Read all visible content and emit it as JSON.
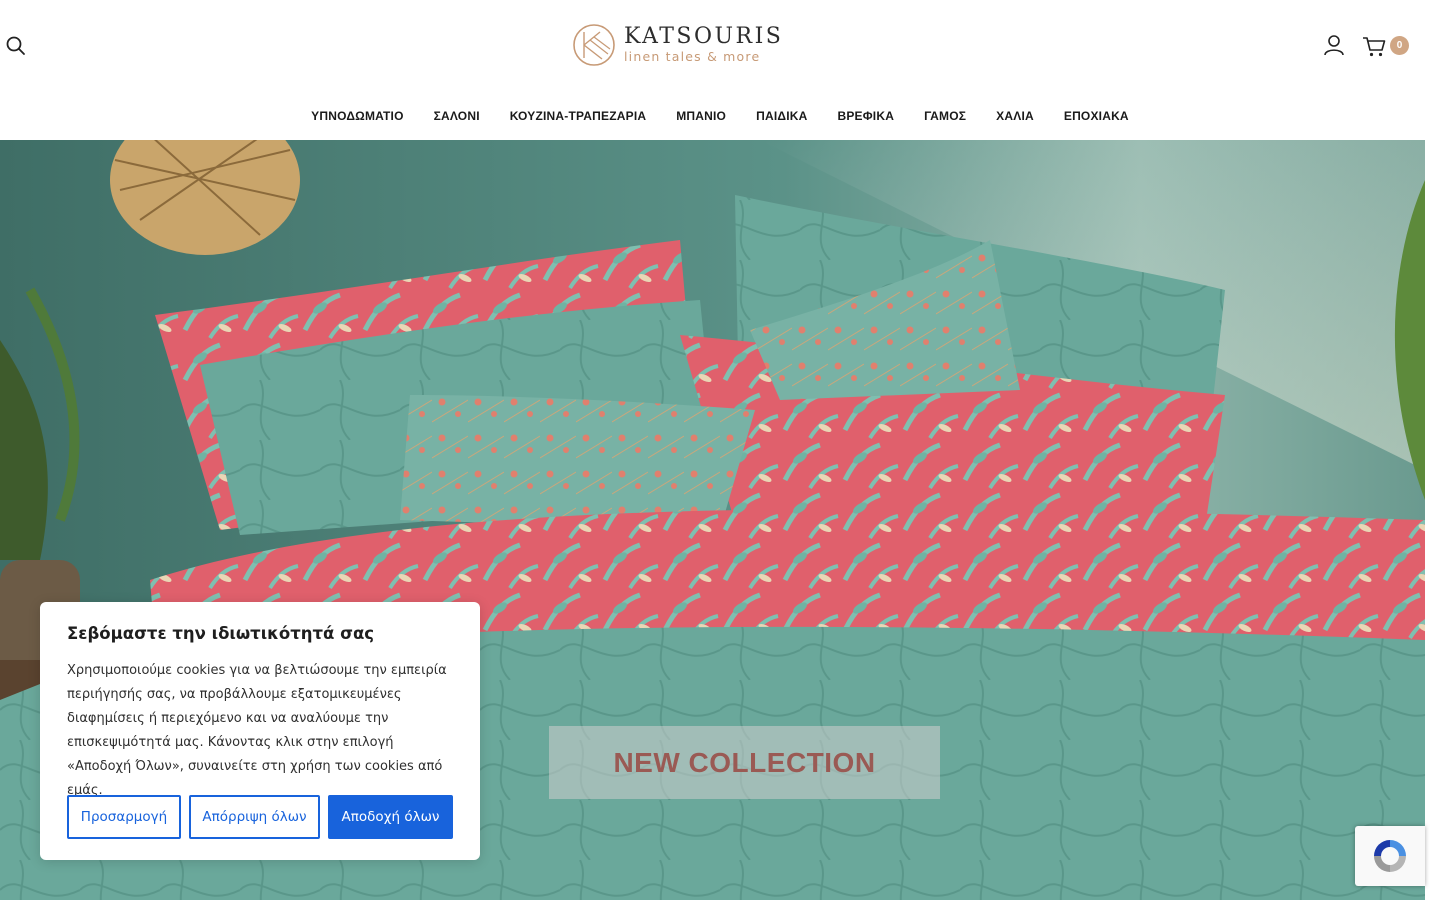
{
  "header": {
    "brand_name": "KATSOURIS",
    "brand_tagline": "linen tales & more",
    "cart_count": "0"
  },
  "icons": {
    "search": "search-icon",
    "user": "user-icon",
    "cart": "cart-icon",
    "logo": "logo-mark-icon",
    "recaptcha": "recaptcha-icon"
  },
  "nav": {
    "items": [
      {
        "label": "ΥΠΝΟΔΩΜΑΤΙΟ"
      },
      {
        "label": "ΣΑΛΟΝΙ"
      },
      {
        "label": "ΚΟΥΖΙΝΑ-ΤΡΑΠΕΖΑΡΙΑ"
      },
      {
        "label": "ΜΠΑΝΙΟ"
      },
      {
        "label": "ΠΑΙΔΙΚΑ"
      },
      {
        "label": "ΒΡΕΦΙΚΑ"
      },
      {
        "label": "ΓΑΜΟΣ"
      },
      {
        "label": "ΧΑΛΙΑ"
      },
      {
        "label": "ΕΠΟΧΙΑΚΑ"
      }
    ]
  },
  "hero": {
    "cta_label": "NEW COLLECTION"
  },
  "cookie": {
    "title": "Σεβόμαστε την ιδιωτικότητά σας",
    "text": "Χρησιμοποιούμε cookies για να βελτιώσουμε την εμπειρία περιήγησής σας, να προβάλλουμε εξατομικευμένες διαφημίσεις ή περιεχόμενο και να αναλύουμε την επισκεψιμότητά μας. Κάνοντας κλικ στην επιλογή «Αποδοχή Όλων», συναινείτε στη χρήση των cookies από εμάς.",
    "customize_label": "Προσαρμογή",
    "reject_label": "Απόρριψη όλων",
    "accept_label": "Αποδοχή όλων"
  },
  "colors": {
    "accent": "#1863dc",
    "brand": "#c79a76",
    "badge": "#d0a684"
  }
}
